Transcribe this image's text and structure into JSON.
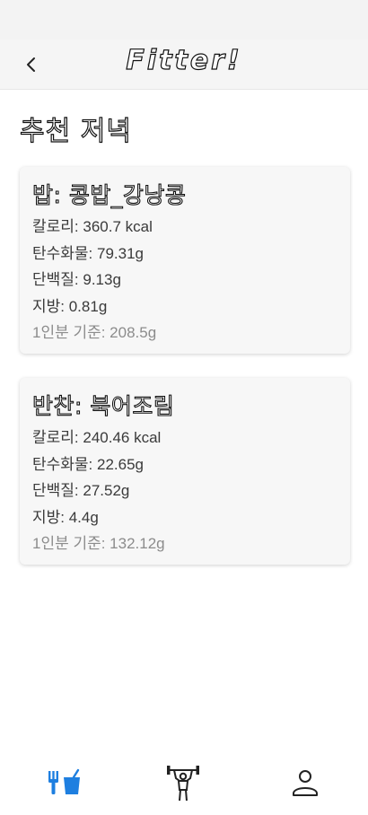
{
  "app": {
    "title": "Fitter!",
    "accent_color": "#1e7fe0"
  },
  "header": {
    "back_icon": "chevron-left-icon"
  },
  "page": {
    "title": "추천 저녁"
  },
  "cards": [
    {
      "title": "밥: 콩밥_강낭콩",
      "calories": "칼로리: 360.7 kcal",
      "carbs": "탄수화물: 79.31g",
      "protein": "단백질: 9.13g",
      "fat": "지방: 0.81g",
      "serving": "1인분 기준: 208.5g"
    },
    {
      "title": "반찬: 북어조림",
      "calories": "칼로리: 240.46 kcal",
      "carbs": "탄수화물: 22.65g",
      "protein": "단백질: 27.52g",
      "fat": "지방: 4.4g",
      "serving": "1인분 기준: 132.12g"
    }
  ],
  "bottom_nav": {
    "items": [
      {
        "icon": "fork-cup-icon",
        "active": true
      },
      {
        "icon": "weightlifting-icon",
        "active": false
      },
      {
        "icon": "profile-icon",
        "active": false
      }
    ]
  }
}
